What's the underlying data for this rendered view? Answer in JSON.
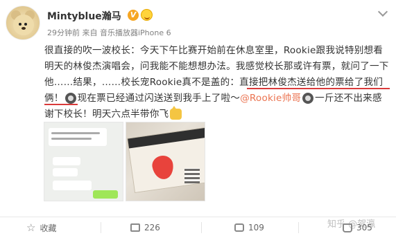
{
  "post": {
    "username": "Mintyblue瀚马",
    "verified_badge": "V",
    "meta": "29分钟前  来自 音乐播放器iPhone 6",
    "text_part1": "很直接的吹一波校长：今天下午比赛开始前在休息室里，Rookie跟我说特别想看明天的林俊杰演唱会，问我能不能想想办法。我感觉校长那或许有票，就问了一下他……结果，……校长宠Rookie真不是盖的：直接把林俊杰送给他的票给了我们俩！",
    "text_part2": "现在票已经通过闪送送到我手上了啦～",
    "mention": "@Rookie帅哥",
    "text_part3": "一斤还不出来感谢下校长！明天六点半带你飞",
    "emoji_icons": [
      "sunglasses-emoji-icon",
      "cat-emoji-icon"
    ]
  },
  "images": [
    {
      "name": "chat-screenshot-image",
      "caption_lines": [
        "老板，Rookie说他想明天去看林俊杰演唱会，你有没有票呀",
        "给你们俩",
        "好好玩一起 想我么",
        "谢谢老板"
      ]
    },
    {
      "name": "ticket-photo-image",
      "label": "JJ 林俊杰 「圣所」世界巡回演唱会"
    }
  ],
  "actions": {
    "favorite_label": "收藏",
    "repost_count": "226",
    "comment_count": "109",
    "like_count": "305"
  },
  "watermark": "知乎 @贺瀛",
  "colors": {
    "mention": "#eb7350",
    "underline": "#d93a3a",
    "badge": "#f6a623"
  }
}
